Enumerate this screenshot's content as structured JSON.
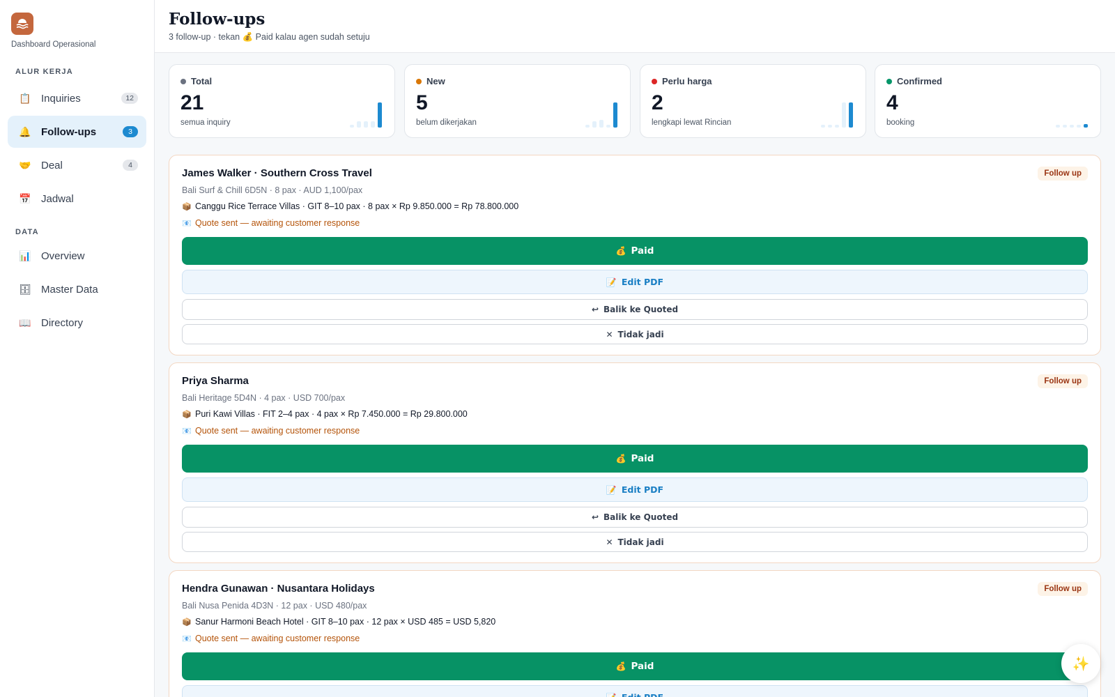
{
  "sidebar": {
    "brand_subtitle": "Dashboard Operasional",
    "sections": [
      {
        "label": "ALUR KERJA"
      },
      {
        "label": "DATA"
      }
    ],
    "items": [
      {
        "label": "Inquiries",
        "icon": "clipboard-icon",
        "badge": "12"
      },
      {
        "label": "Follow-ups",
        "icon": "bell-icon",
        "badge": "3",
        "active": true
      },
      {
        "label": "Deal",
        "icon": "handshake-icon",
        "badge": "4"
      },
      {
        "label": "Jadwal",
        "icon": "calendar-icon",
        "badge": ""
      },
      {
        "label": "Overview",
        "icon": "bar-chart-icon",
        "badge": ""
      },
      {
        "label": "Master Data",
        "icon": "cabinet-icon",
        "badge": ""
      },
      {
        "label": "Directory",
        "icon": "book-icon",
        "badge": ""
      }
    ]
  },
  "header": {
    "title": "Follow-ups",
    "subtitle_prefix": "3 follow-up · tekan ",
    "subtitle_suffix": " Paid kalau agen sudah setuju"
  },
  "stats": [
    {
      "label": "Total",
      "value": "21",
      "desc": "semua inquiry",
      "color": "#6b7280"
    },
    {
      "label": "New",
      "value": "5",
      "desc": "belum dikerjakan",
      "color": "#d97706"
    },
    {
      "label": "Perlu harga",
      "value": "2",
      "desc": "lengkapi lewat Rincian",
      "color": "#dc2626"
    },
    {
      "label": "Confirmed",
      "value": "4",
      "desc": "booking",
      "color": "#059669"
    }
  ],
  "followups": [
    {
      "title": "James Walker · Southern Cross Travel",
      "pill": "Follow up",
      "meta": "Bali Surf & Chill 6D5N · 8 pax · AUD 1,100/pax",
      "line": "Canggu Rice Terrace Villas · GIT 8–10 pax · 8 pax × Rp 9.850.000 = Rp 78.800.000",
      "status": "Quote sent — awaiting customer response"
    },
    {
      "title": "Priya Sharma",
      "pill": "Follow up",
      "meta": "Bali Heritage 5D4N · 4 pax · USD 700/pax",
      "line": "Puri Kawi Villas · FIT 2–4 pax · 4 pax × Rp 7.450.000 = Rp 29.800.000",
      "status": "Quote sent — awaiting customer response"
    },
    {
      "title": "Hendra Gunawan · Nusantara Holidays",
      "pill": "Follow up",
      "meta": "Bali Nusa Penida 4D3N · 12 pax · USD 480/pax",
      "line": "Sanur Harmoni Beach Hotel · GIT 8–10 pax · 12 pax × USD 485 = USD 5,820",
      "status": "Quote sent — awaiting customer response"
    }
  ],
  "actions": {
    "paid": "Paid",
    "edit_pdf": "Edit PDF",
    "back_quoted": "Balik ke Quoted",
    "cancel": "Tidak jadi"
  },
  "colors": {
    "accent": "#1d8ad0",
    "paid": "#079265",
    "brand": "#c4673d"
  }
}
